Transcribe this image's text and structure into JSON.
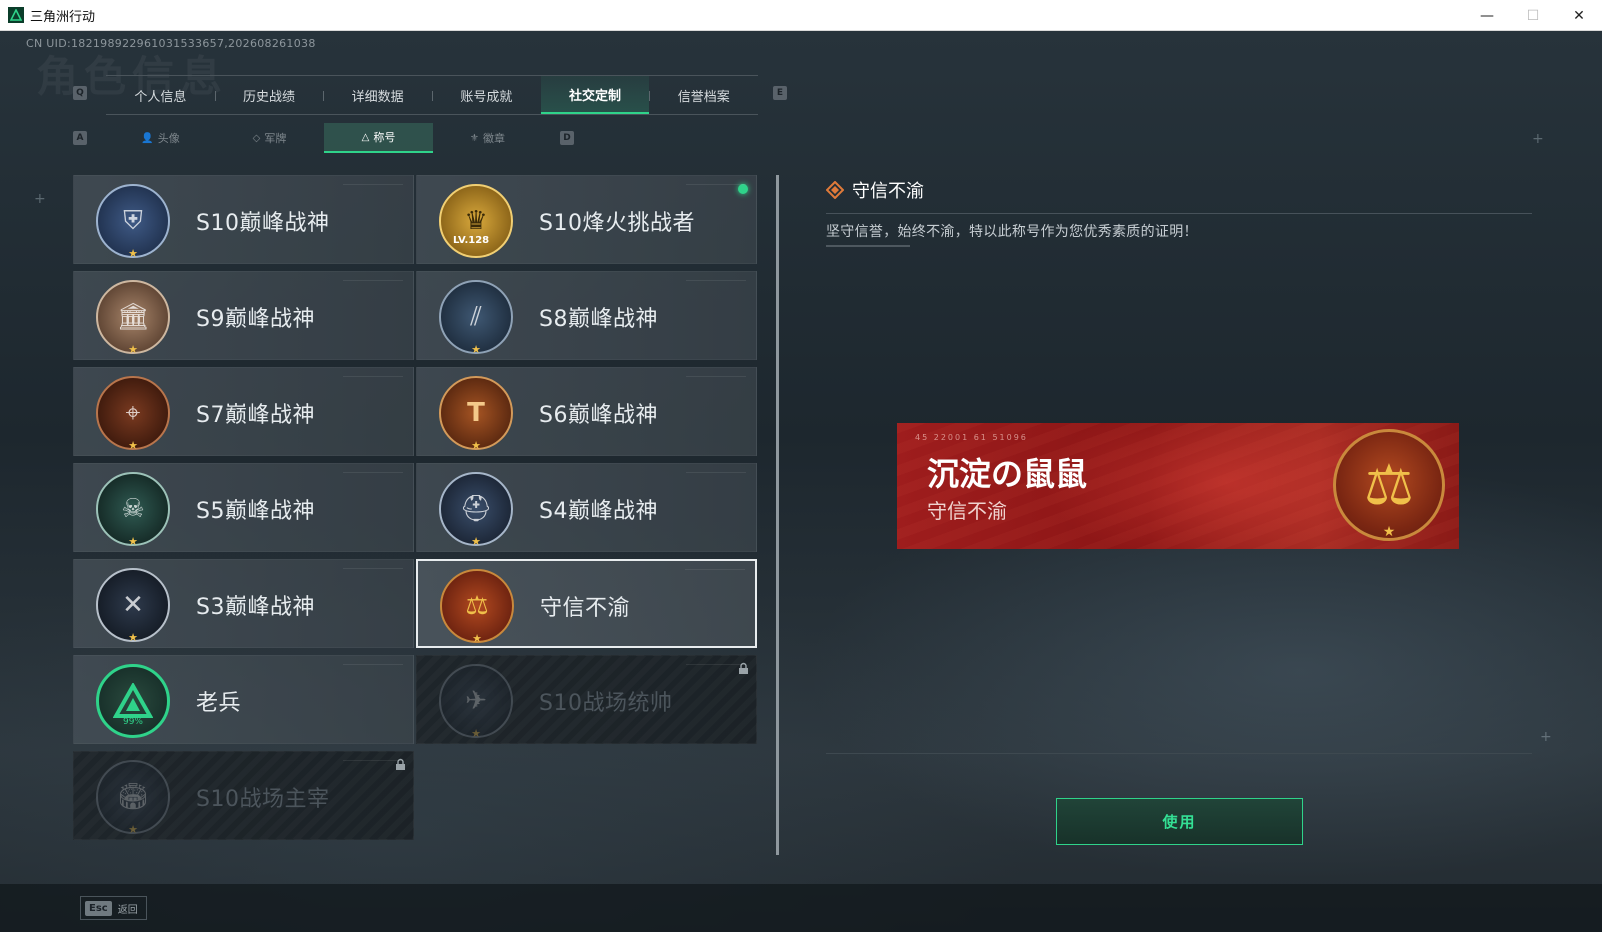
{
  "window": {
    "title": "三角洲行动",
    "minimize": "—",
    "maximize": "☐",
    "close": "✕"
  },
  "game": {
    "uid": "CN UID:1821989229610315336​57,202608261038"
  },
  "keyhints": {
    "prev_tab": "Q",
    "next_tab": "E",
    "prev_sub": "A",
    "next_sub": "D"
  },
  "main_tabs": [
    {
      "label": "个人信息",
      "active": false
    },
    {
      "label": "历史战绩",
      "active": false
    },
    {
      "label": "详细数据",
      "active": false
    },
    {
      "label": "账号成就",
      "active": false
    },
    {
      "label": "社交定制",
      "active": true
    },
    {
      "label": "信誉档案",
      "active": false
    }
  ],
  "sub_tabs": [
    {
      "label": "头像",
      "icon": "person-icon",
      "active": false
    },
    {
      "label": "军牌",
      "icon": "dogtag-icon",
      "active": false
    },
    {
      "label": "称号",
      "icon": "title-icon",
      "active": true
    },
    {
      "label": "徽章",
      "icon": "emblem-icon",
      "active": false
    }
  ],
  "titles": [
    {
      "label": "S10巅峰战神",
      "badge": "shield-badge-icon",
      "state": "normal"
    },
    {
      "label": "S10烽火挑战者",
      "badge": "gold-helmet-badge-icon",
      "state": "normal",
      "new": true,
      "level": "LV.128"
    },
    {
      "label": "S9巅峰战神",
      "badge": "fortress-badge-icon",
      "state": "normal"
    },
    {
      "label": "S8巅峰战神",
      "badge": "stripes-badge-icon",
      "state": "normal"
    },
    {
      "label": "S7巅峰战神",
      "badge": "rifle-badge-icon",
      "state": "normal"
    },
    {
      "label": "S6巅峰战神",
      "badge": "t-shield-badge-icon",
      "state": "normal"
    },
    {
      "label": "S5巅峰战神",
      "badge": "skull-badge-icon",
      "state": "normal"
    },
    {
      "label": "S4巅峰战神",
      "badge": "helmet-badge-icon",
      "state": "normal"
    },
    {
      "label": "S3巅峰战神",
      "badge": "globe-badge-icon",
      "state": "normal"
    },
    {
      "label": "守信不渝",
      "badge": "scales-badge-icon",
      "state": "selected"
    },
    {
      "label": "老兵",
      "badge": "delta-badge-icon",
      "state": "normal",
      "progress_label": "99%"
    },
    {
      "label": "S10战场统帅",
      "badge": "aircraft-badge-icon",
      "state": "locked"
    },
    {
      "label": "S10战场主宰",
      "badge": "colosseum-badge-icon",
      "state": "locked"
    }
  ],
  "detail": {
    "title": "守信不渝",
    "description": "坚守信誉，始终不渝，特以此称号作为您优秀素质的证明！",
    "preview_name": "沉淀の鼠鼠",
    "preview_subtitle": "守信不渝",
    "preview_corner": "45 22001 61 51096",
    "use_button": "使用"
  },
  "bottom": {
    "esc_key": "Esc",
    "esc_label": "返回"
  },
  "colors": {
    "accent": "#2fd38a",
    "banner_red": "#9e1d1d",
    "gold": "#f0c04a"
  }
}
